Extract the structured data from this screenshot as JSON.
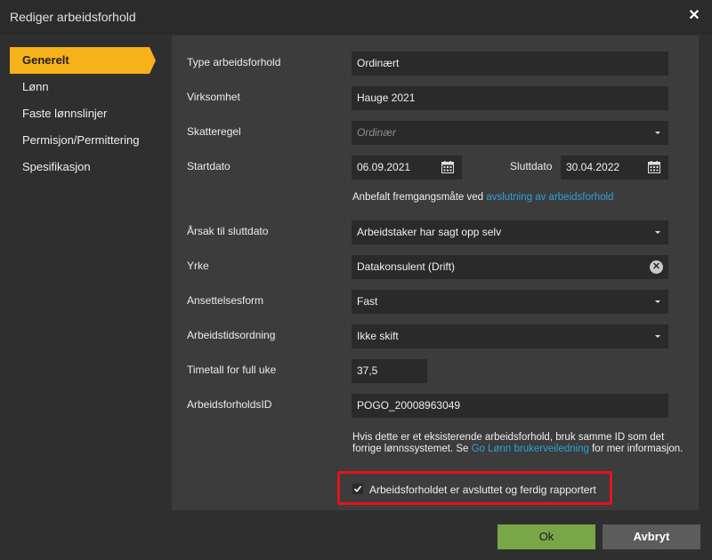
{
  "dialog": {
    "title": "Rediger arbeidsforhold",
    "close_icon": "close-icon"
  },
  "sidebar": {
    "items": [
      {
        "label": "Generelt",
        "active": true
      },
      {
        "label": "Lønn"
      },
      {
        "label": "Faste lønnslinjer"
      },
      {
        "label": "Permisjon/Permittering"
      },
      {
        "label": "Spesifikasjon"
      }
    ],
    "active_color": "#f7b21a"
  },
  "form": {
    "type": {
      "label": "Type arbeidsforhold",
      "value": "Ordinært"
    },
    "virksomhet": {
      "label": "Virksomhet",
      "value": "Hauge 2021"
    },
    "skatteregel": {
      "label": "Skatteregel",
      "placeholder": "Ordinær"
    },
    "startdato": {
      "label": "Startdato",
      "value": "06.09.2021"
    },
    "sluttdato": {
      "label": "Sluttdato",
      "value": "30.04.2022"
    },
    "hint": {
      "text": "Anbefalt fremgangsmåte ved ",
      "link": "avslutning av arbeidsforhold"
    },
    "aarsak": {
      "label": "Årsak til sluttdato",
      "value": "Arbeidstaker har sagt opp selv"
    },
    "yrke": {
      "label": "Yrke",
      "value": "Datakonsulent (Drift)"
    },
    "ansettelsesform": {
      "label": "Ansettelsesform",
      "value": "Fast"
    },
    "arbeidstid": {
      "label": "Arbeidstidsordning",
      "value": "Ikke skift"
    },
    "timetall": {
      "label": "Timetall for full uke",
      "value": "37,5"
    },
    "id": {
      "label": "ArbeidsforholdsID",
      "value": "POGO_20008963049"
    },
    "info": {
      "text_before": "Hvis dette er et eksisterende arbeidsforhold, bruk samme ID som det forrige lønnssystemet. Se ",
      "link": "Go Lønn brukerveiledning",
      "text_after": " for mer informasjon."
    },
    "avsluttet": {
      "label": "Arbeidsforholdet er avsluttet og ferdig rapportert",
      "checked": true
    }
  },
  "footer": {
    "ok_label": "Ok",
    "cancel_label": "Avbryt",
    "ok_color": "#79a647"
  }
}
